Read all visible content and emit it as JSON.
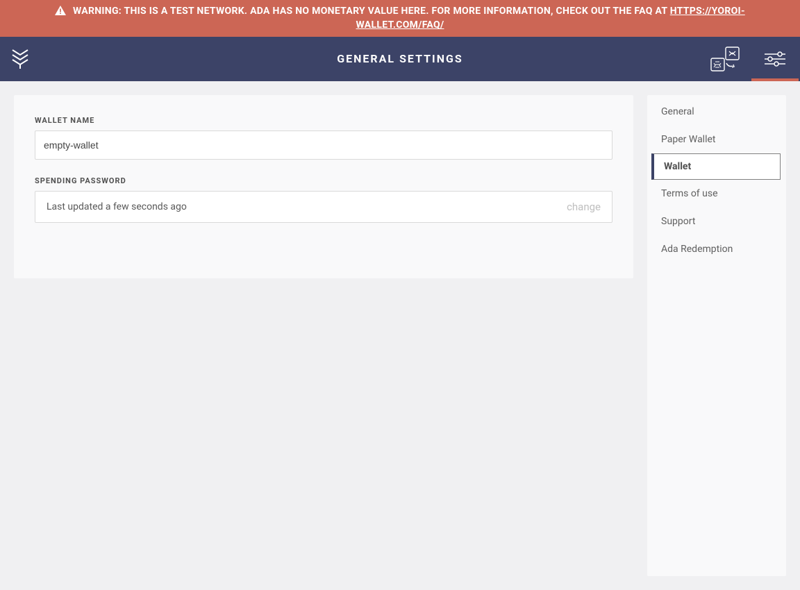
{
  "warning": {
    "text_before_link": "WARNING: THIS IS A TEST NETWORK. ADA HAS NO MONETARY VALUE HERE. FOR MORE INFORMATION, CHECK OUT THE FAQ AT ",
    "link_text": "HTTPS://YOROI-WALLET.COM/FAQ/"
  },
  "header": {
    "title": "GENERAL SETTINGS"
  },
  "form": {
    "wallet_name_label": "WALLET NAME",
    "wallet_name_value": "empty-wallet",
    "spending_password_label": "SPENDING PASSWORD",
    "spending_password_info": "Last updated a few seconds ago",
    "change_label": "change"
  },
  "sidebar": {
    "items": [
      {
        "label": "General",
        "selected": false
      },
      {
        "label": "Paper Wallet",
        "selected": false
      },
      {
        "label": "Wallet",
        "selected": true
      },
      {
        "label": "Terms of use",
        "selected": false
      },
      {
        "label": "Support",
        "selected": false
      },
      {
        "label": "Ada Redemption",
        "selected": false
      }
    ]
  }
}
